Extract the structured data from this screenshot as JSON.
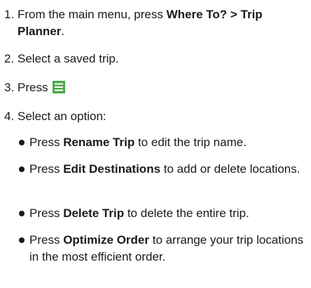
{
  "steps": [
    {
      "number": "1.",
      "text_before": "From the main menu, press ",
      "bold": "Where To? > Trip Planner",
      "text_after": "."
    },
    {
      "number": "2.",
      "text": "Select a saved trip."
    },
    {
      "number": "3.",
      "text": "Press",
      "icon": "menu-icon",
      "icon_color": "#4ba84a"
    },
    {
      "number": "4.",
      "text": "Select an option:"
    }
  ],
  "options": [
    {
      "prefix": "Press ",
      "bold": "Rename Trip",
      "suffix": " to edit the trip name."
    },
    {
      "prefix": "Press ",
      "bold": "Edit Destinations",
      "suffix": " to add or delete locations."
    },
    {
      "prefix": "Press ",
      "bold": "Delete Trip",
      "suffix": " to delete the entire trip."
    },
    {
      "prefix": "Press ",
      "bold": "Optimize Order",
      "suffix": " to arrange your trip locations in the most efficient order."
    }
  ]
}
